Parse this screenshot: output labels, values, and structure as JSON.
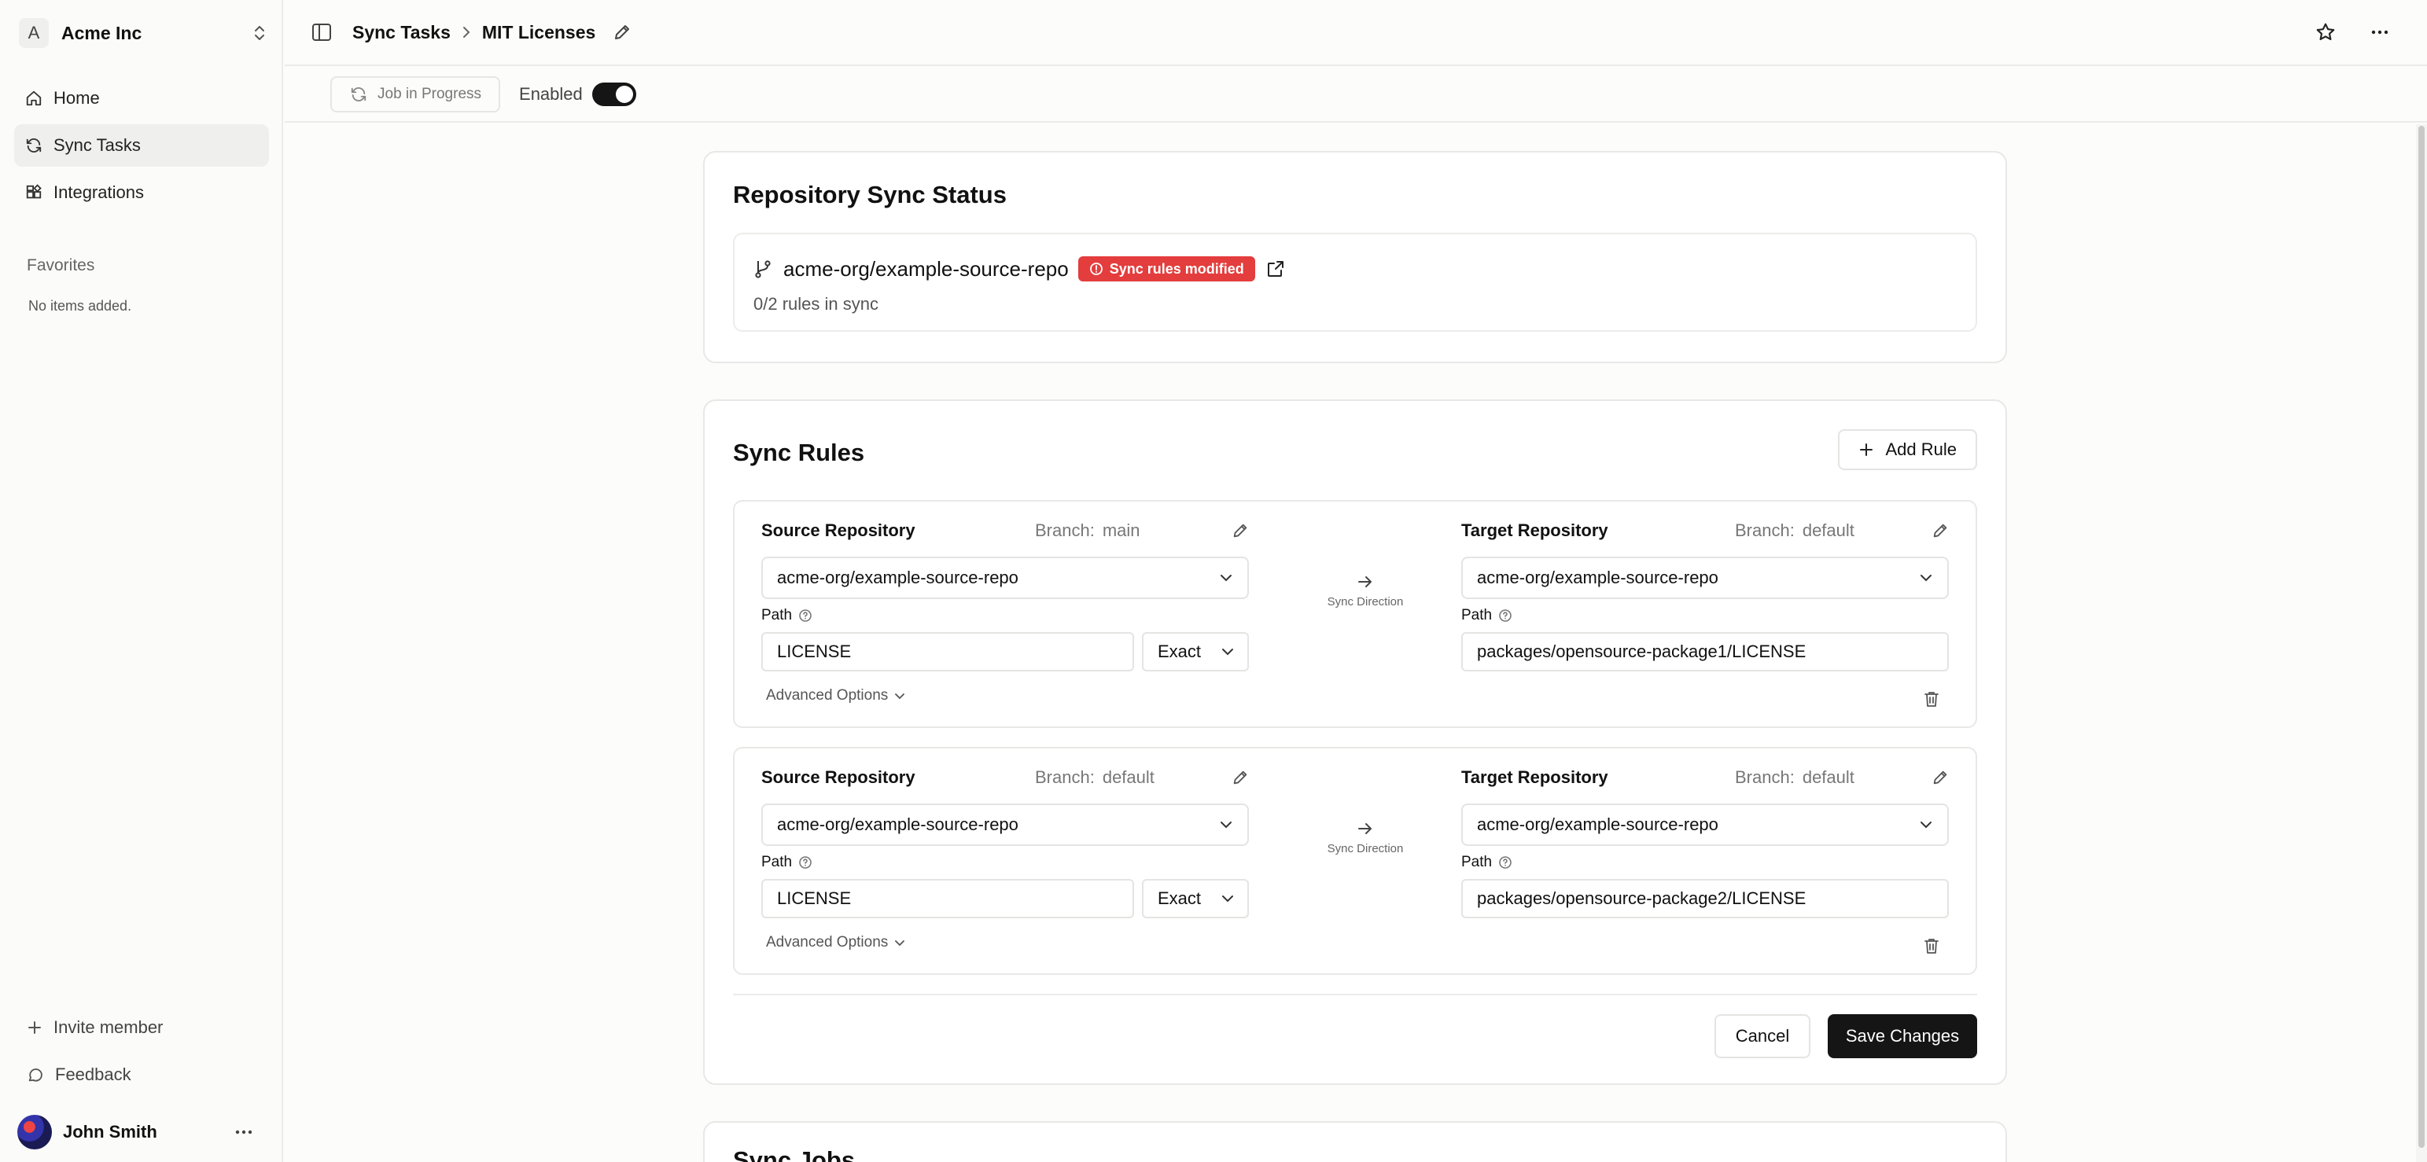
{
  "org": {
    "initial": "A",
    "name": "Acme Inc"
  },
  "nav": [
    {
      "label": "Home",
      "icon": "home-icon"
    },
    {
      "label": "Sync Tasks",
      "icon": "refresh-icon",
      "active": true
    },
    {
      "label": "Integrations",
      "icon": "integrations-icon"
    }
  ],
  "favorites": {
    "title": "Favorites",
    "empty": "No items added."
  },
  "footer": {
    "invite": "Invite member",
    "feedback": "Feedback"
  },
  "user": {
    "name": "John Smith"
  },
  "breadcrumb": {
    "parent": "Sync Tasks",
    "current": "MIT Licenses"
  },
  "toolbar": {
    "job_status": "Job in Progress",
    "enabled_label": "Enabled",
    "enabled": true
  },
  "status_card": {
    "title": "Repository Sync Status",
    "repo": "acme-org/example-source-repo",
    "badge": "Sync rules modified",
    "rules_in_sync": "0/2 rules in sync"
  },
  "rules_card": {
    "title": "Sync Rules",
    "add_label": "Add Rule",
    "branch_prefix": "Branch:",
    "path_label": "Path",
    "advanced_label": "Advanced Options",
    "direction_label": "Sync Direction",
    "source_title": "Source Repository",
    "target_title": "Target Repository",
    "rules": [
      {
        "source": {
          "branch": "main",
          "repo": "acme-org/example-source-repo",
          "path": "LICENSE",
          "match": "Exact"
        },
        "target": {
          "branch": "default",
          "repo": "acme-org/example-source-repo",
          "path": "packages/opensource-package1/LICENSE"
        }
      },
      {
        "source": {
          "branch": "default",
          "repo": "acme-org/example-source-repo",
          "path": "LICENSE",
          "match": "Exact"
        },
        "target": {
          "branch": "default",
          "repo": "acme-org/example-source-repo",
          "path": "packages/opensource-package2/LICENSE"
        }
      }
    ],
    "cancel_label": "Cancel",
    "save_label": "Save Changes"
  },
  "jobs_card": {
    "title": "Sync Jobs"
  },
  "colors": {
    "accent": "#151515",
    "badge": "#e43d3d"
  }
}
